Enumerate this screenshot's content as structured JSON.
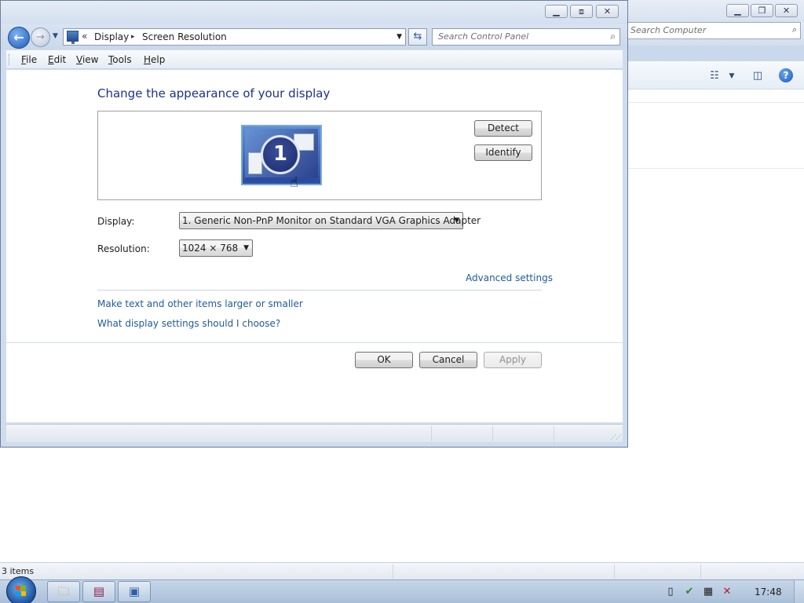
{
  "background_window": {
    "search_placeholder": "Search Computer",
    "status_text": "3 items"
  },
  "window": {
    "title_buttons": {
      "minimize": "▁",
      "maximize": "□",
      "close": "✕"
    },
    "address": {
      "chevrons": "«",
      "breadcrumbs": [
        "Display",
        "Screen Resolution"
      ],
      "separator": "▸"
    },
    "search_placeholder": "Search Control Panel",
    "menu": [
      "File",
      "Edit",
      "View",
      "Tools",
      "Help"
    ]
  },
  "content": {
    "title": "Change the appearance of your display",
    "monitor_number": "1",
    "buttons": {
      "detect": "Detect",
      "identify": "Identify"
    },
    "display_label": "Display:",
    "display_value": "1. Generic Non-PnP Monitor on Standard VGA Graphics Adapter",
    "resolution_label": "Resolution:",
    "resolution_value": "1024 × 768",
    "advanced_link": "Advanced settings",
    "links": [
      "Make text and other items larger or smaller",
      "What display settings should I choose?"
    ],
    "footer_buttons": {
      "ok": "OK",
      "cancel": "Cancel",
      "apply": "Apply"
    }
  },
  "taskbar": {
    "clock": "17:48"
  },
  "colors": {
    "title_text": "#1e3287",
    "link": "#1f5a99",
    "taskbar": "#b9cce2"
  }
}
